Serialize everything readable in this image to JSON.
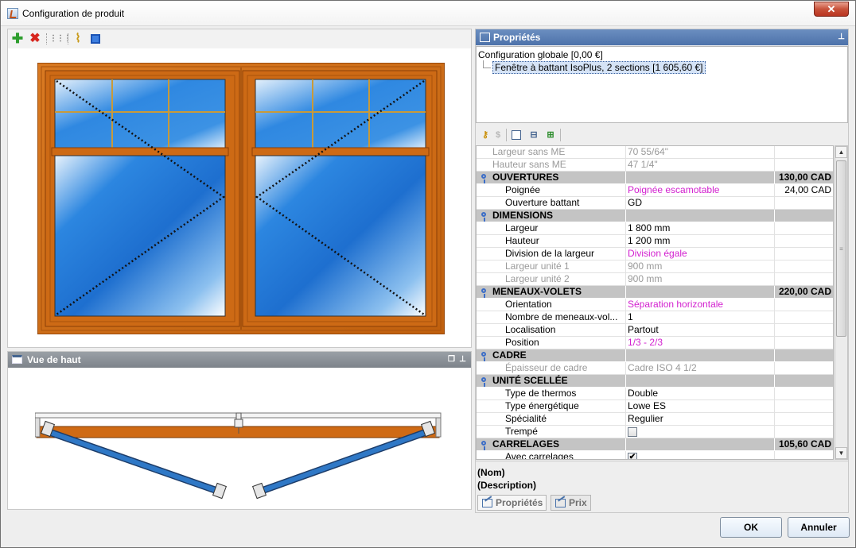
{
  "window": {
    "title": "Configuration de produit",
    "close_label": "✕"
  },
  "colors": {
    "frame_wood": "#cf6a14",
    "glass_blue": "#1f78d6",
    "group_row_bg": "#c4c4c4",
    "magenta_value": "#d21fcf",
    "props_header": "#5a7fb5"
  },
  "left_toolbar": {
    "icons": [
      "add-icon",
      "delete-icon",
      "grid-icon",
      "brush-icon",
      "select-icon"
    ]
  },
  "top_view": {
    "title": "Vue de haut"
  },
  "properties": {
    "title": "Propriétés",
    "tree": {
      "root": "Configuration globale [0,00 €]",
      "child": "Fenêtre à battant IsoPlus, 2 sections [1 605,60 €]"
    },
    "toolbar_icons": [
      "key-icon",
      "dollar-icon",
      "collapse-icon",
      "tree-icon",
      "tree-expand-icon"
    ],
    "rows": [
      {
        "type": "prop",
        "name": "Largeur sans ME",
        "value": "70 55/64\"",
        "price": "",
        "disabled": true,
        "magenta": false
      },
      {
        "type": "prop",
        "name": "Hauteur sans ME",
        "value": "47 1/4\"",
        "price": "",
        "disabled": true,
        "magenta": false
      },
      {
        "type": "group",
        "name": "OUVERTURES",
        "value": "",
        "price": "130,00 CAD"
      },
      {
        "type": "prop",
        "name": "Poignée",
        "value": "Poignée escamotable",
        "price": "24,00 CAD",
        "disabled": false,
        "magenta": true
      },
      {
        "type": "prop",
        "name": "Ouverture battant",
        "value": "GD",
        "price": "",
        "disabled": false,
        "magenta": false
      },
      {
        "type": "group",
        "name": "DIMENSIONS",
        "value": "",
        "price": ""
      },
      {
        "type": "prop",
        "name": "Largeur",
        "value": "1 800 mm",
        "price": "",
        "disabled": false,
        "magenta": false
      },
      {
        "type": "prop",
        "name": "Hauteur",
        "value": "1 200 mm",
        "price": "",
        "disabled": false,
        "magenta": false
      },
      {
        "type": "prop",
        "name": "Division de la largeur",
        "value": "Division égale",
        "price": "",
        "disabled": false,
        "magenta": true
      },
      {
        "type": "prop",
        "name": "Largeur unité 1",
        "value": "900 mm",
        "price": "",
        "disabled": true,
        "magenta": false
      },
      {
        "type": "prop",
        "name": "Largeur unité 2",
        "value": "900 mm",
        "price": "",
        "disabled": true,
        "magenta": false
      },
      {
        "type": "group",
        "name": "MENEAUX-VOLETS",
        "value": "",
        "price": "220,00 CAD"
      },
      {
        "type": "prop",
        "name": "Orientation",
        "value": "Séparation horizontale",
        "price": "",
        "disabled": false,
        "magenta": true
      },
      {
        "type": "prop",
        "name": "Nombre de meneaux-vol...",
        "value": "1",
        "price": "",
        "disabled": false,
        "magenta": false
      },
      {
        "type": "prop",
        "name": "Localisation",
        "value": "Partout",
        "price": "",
        "disabled": false,
        "magenta": false
      },
      {
        "type": "prop",
        "name": "Position",
        "value": "1/3 - 2/3",
        "price": "",
        "disabled": false,
        "magenta": true
      },
      {
        "type": "group",
        "name": "CADRE",
        "value": "",
        "price": ""
      },
      {
        "type": "prop",
        "name": "Épaisseur de cadre",
        "value": "Cadre ISO 4 1/2",
        "price": "",
        "disabled": true,
        "magenta": false
      },
      {
        "type": "group",
        "name": "UNITÉ SCELLÉE",
        "value": "",
        "price": ""
      },
      {
        "type": "prop",
        "name": "Type de thermos",
        "value": "Double",
        "price": "",
        "disabled": false,
        "magenta": false
      },
      {
        "type": "prop",
        "name": "Type énergétique",
        "value": "Lowe ES",
        "price": "",
        "disabled": false,
        "magenta": false
      },
      {
        "type": "prop",
        "name": "Spécialité",
        "value": "Regulier",
        "price": "",
        "disabled": false,
        "magenta": false
      },
      {
        "type": "check",
        "name": "Trempé",
        "checked": false
      },
      {
        "type": "group",
        "name": "CARRELAGES",
        "value": "",
        "price": "105,60 CAD"
      },
      {
        "type": "check",
        "name": "Avec carrelages",
        "checked": true
      }
    ],
    "description": {
      "name_placeholder": "(Nom)",
      "description_placeholder": "(Description)"
    },
    "tabs": [
      "Propriétés",
      "Prix"
    ]
  },
  "buttons": {
    "ok": "OK",
    "cancel": "Annuler"
  }
}
